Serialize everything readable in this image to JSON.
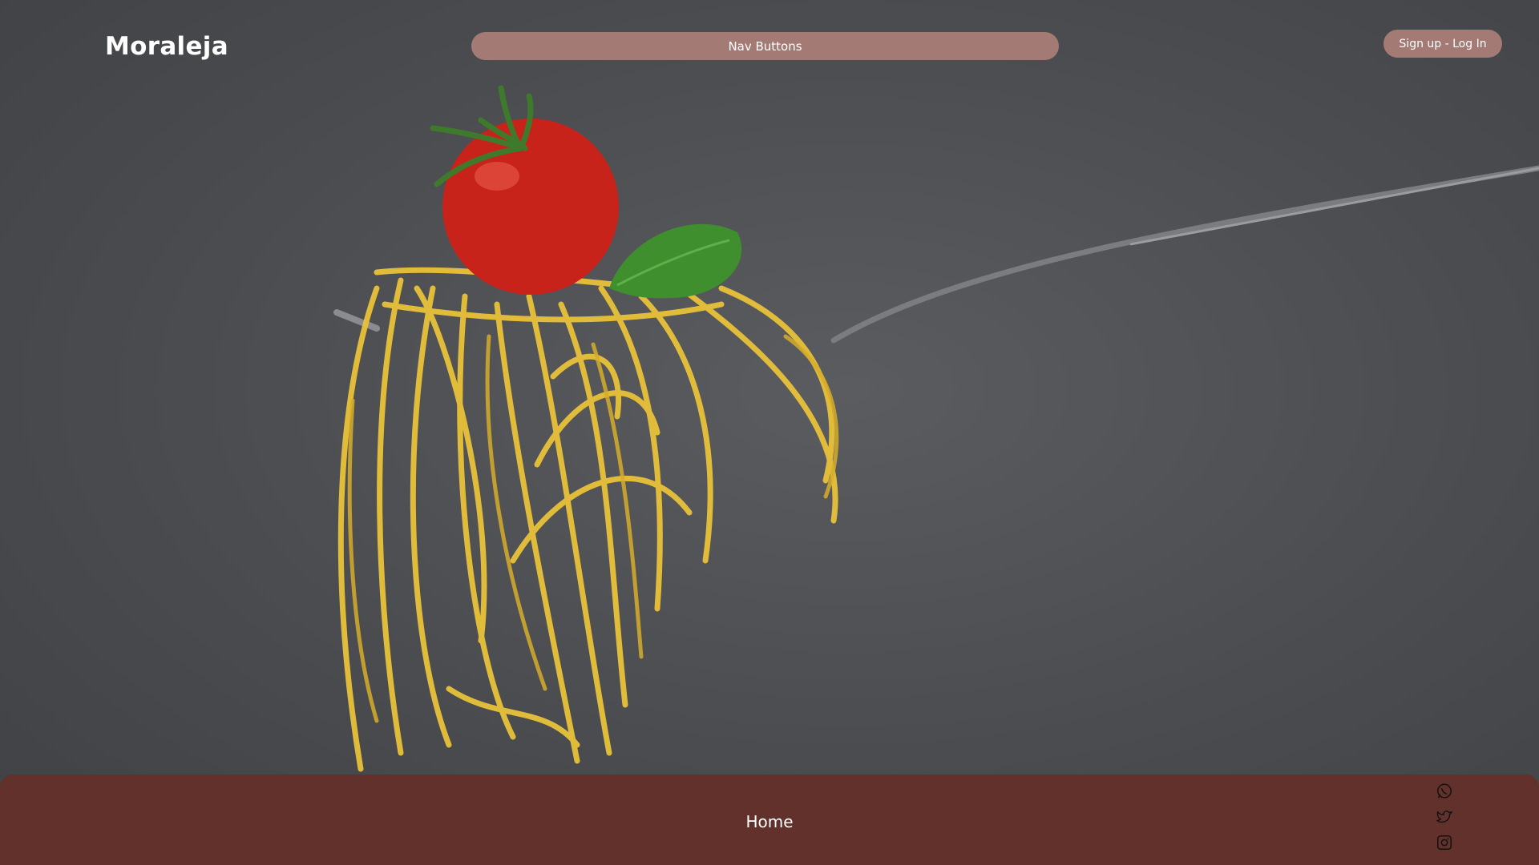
{
  "header": {
    "logo": "Moraleja",
    "nav_label": "Nav Buttons",
    "auth_label": "Sign up - Log In"
  },
  "hero": {
    "image_description_icon": "spaghetti-fork-photo"
  },
  "footer": {
    "label": "Home",
    "social": [
      "whatsapp-icon",
      "twitter-icon",
      "instagram-icon"
    ]
  },
  "colors": {
    "accent": "#a37b74",
    "footer": "#62312b",
    "background": "#4d4f52"
  }
}
